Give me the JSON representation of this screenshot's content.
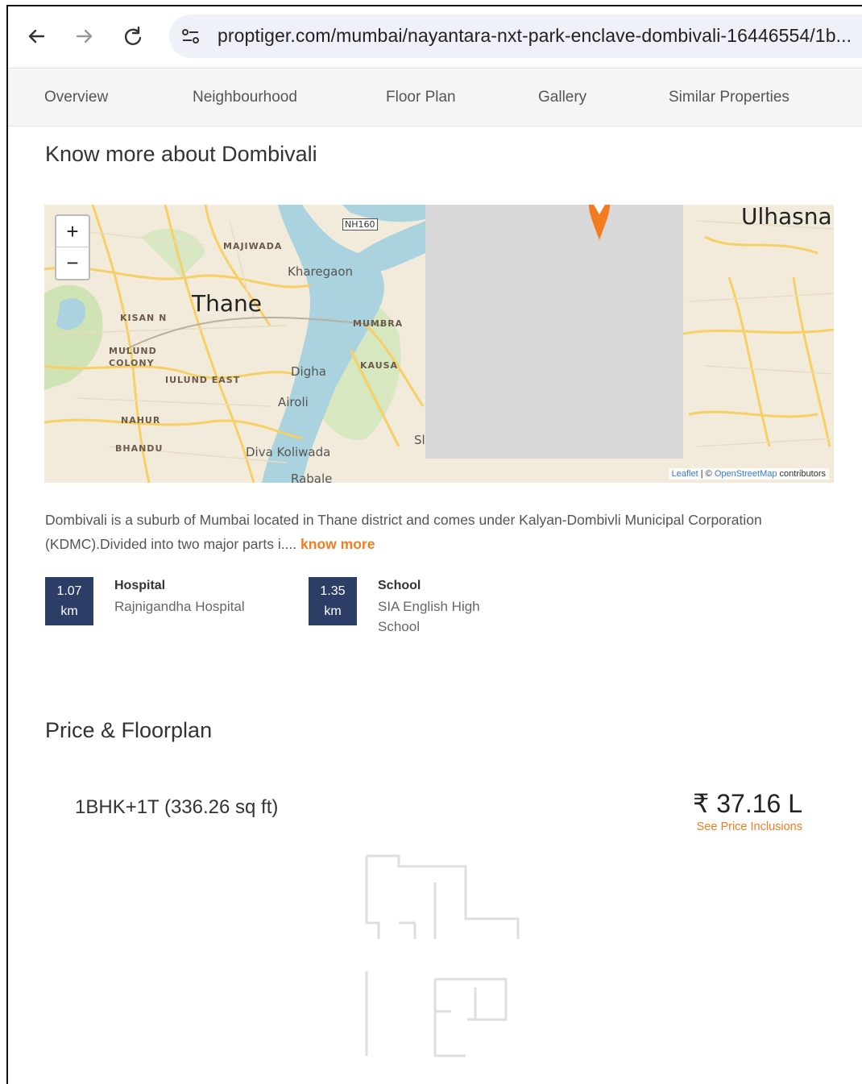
{
  "browser": {
    "url": "proptiger.com/mumbai/nayantara-nxt-park-enclave-dombivali-16446554/1b..."
  },
  "tabs": [
    {
      "label": "Overview"
    },
    {
      "label": "Neighbourhood"
    },
    {
      "label": "Floor Plan"
    },
    {
      "label": "Gallery"
    },
    {
      "label": "Similar Properties"
    }
  ],
  "neighbourhood": {
    "title": "Know more about Dombivali",
    "map": {
      "zoom_in": "+",
      "zoom_out": "−",
      "labels": {
        "thane": "Thane",
        "ulhasna": "Ulhasna",
        "majiwada": "MAJIWADA",
        "kharegaon": "Kharegaon",
        "nh160": "NH160",
        "kisan": "KISAN N",
        "mulund_colony_1": "MULUND",
        "mulund_colony_2": "COLONY",
        "mumbra": "MUMBRA",
        "kausa": "KAUSA",
        "mulund_east": "IULUND EAST",
        "digha": "Digha",
        "airoli": "Airoli",
        "nahur": "NAHUR",
        "bhandu": "BHANDU",
        "diva": "Diva Koliwada",
        "rabale": "Rabale",
        "sl": "Sl"
      },
      "attribution": {
        "leaflet": "Leaflet",
        "sep": " | © ",
        "osm": "OpenStreetMap",
        "contrib": " contributors"
      },
      "colors": {
        "marker": "#f47c20",
        "water": "#aad3df",
        "road": "#f6cf65"
      }
    },
    "description": "Dombivali is a suburb of Mumbai located in Thane district and comes under Kalyan-Dombivli Municipal Corporation (KDMC).Divided into two major parts i....",
    "know_more": "know more",
    "poi": [
      {
        "distance": "1.07",
        "unit": "km",
        "type": "Hospital",
        "name": "Rajnigandha Hospital"
      },
      {
        "distance": "1.35",
        "unit": "km",
        "type": "School",
        "name": "SIA English High School"
      }
    ]
  },
  "pricing": {
    "title": "Price & Floorplan",
    "unit_config": "1BHK+1T (336.26 sq ft)",
    "price": "₹ 37.16 L",
    "price_link": "See Price Inclusions"
  },
  "colors": {
    "accent": "#f47c20",
    "badge": "#2c3e66"
  }
}
